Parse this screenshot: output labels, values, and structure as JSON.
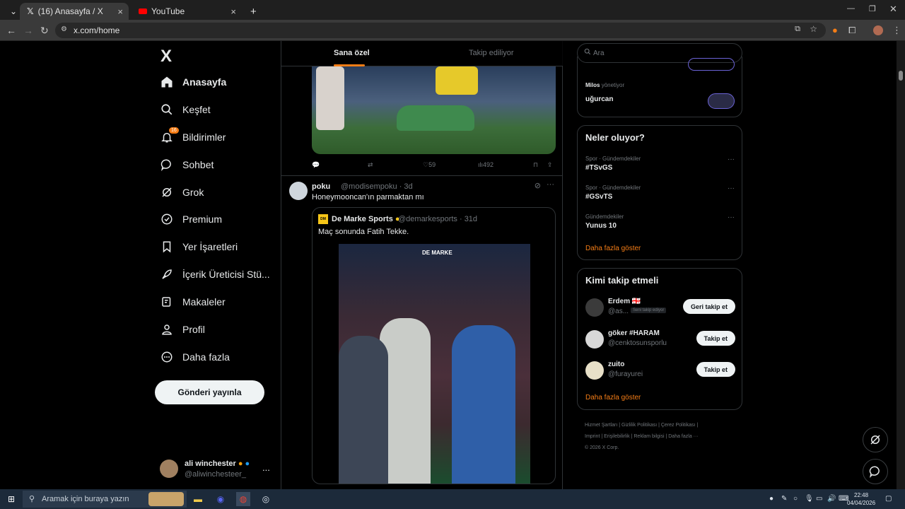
{
  "browser": {
    "tabs": [
      {
        "label": "(16) Anasayfa / X",
        "close": "×"
      },
      {
        "label": "YouTube",
        "close": "×"
      }
    ],
    "new_tab": "+",
    "url": "x.com/home"
  },
  "sidebar": {
    "logo": "X",
    "items": [
      {
        "label": "Anasayfa"
      },
      {
        "label": "Keşfet"
      },
      {
        "label": "Bildirimler",
        "badge": "16"
      },
      {
        "label": "Sohbet"
      },
      {
        "label": "Grok"
      },
      {
        "label": "Premium"
      },
      {
        "label": "Yer İşaretleri"
      },
      {
        "label": "İçerik Üreticisi Stü..."
      },
      {
        "label": "Makaleler"
      },
      {
        "label": "Profil"
      },
      {
        "label": "Daha fazla"
      }
    ],
    "post_button": "Gönderi yayınla",
    "account": {
      "name": "ali winchester",
      "handle": "@aliwinchesteer_",
      "more": "..."
    }
  },
  "feed": {
    "tabs": [
      {
        "label": "Sana özel"
      },
      {
        "label": "Takip ediliyor"
      }
    ],
    "tweet1_actions": {
      "likes": "59",
      "views": "492"
    },
    "tweet2": {
      "name": "poku",
      "meta": "@modisempoku · 3d",
      "text": "Honeymooncan'ın parmaktan mı",
      "more": "···",
      "quote": {
        "name": "De Marke Sports",
        "meta": "@demarkesports · 31d",
        "text": "Maç sonunda Fatih Tekke.",
        "watermark": "DE MARKE"
      }
    }
  },
  "right": {
    "search_placeholder": "Ara",
    "community": {
      "manager": "Milos",
      "manager_suffix": "yönetiyor",
      "name": "uğurcan"
    },
    "trends": {
      "title": "Neler oluyor?",
      "items": [
        {
          "category": "Spor · Gündemdekiler",
          "name": "#TSvGS"
        },
        {
          "category": "Spor · Gündemdekiler",
          "name": "#GSvTS"
        },
        {
          "category": "Gündemdekiler",
          "name": "Yunus 10"
        }
      ],
      "show_more": "Daha fazla göster"
    },
    "who_to_follow": {
      "title": "Kimi takip etmeli",
      "items": [
        {
          "name": "Erdem 🇬🇪",
          "handle": "@as...",
          "badge": "Seni takip ediyor",
          "button": "Geri takip et"
        },
        {
          "name": "göker #HARAM",
          "handle": "@cenktosunsporlu",
          "button": "Takip et"
        },
        {
          "name": "zuito",
          "handle": "@furayurei",
          "button": "Takip et"
        }
      ],
      "show_more": "Daha fazla göster"
    },
    "footer": {
      "line1": "Hizmet Şartları  |  Gizlilik Politikası  |  Çerez Politikası  |",
      "line2": "Imprint  |  Erişilebilirlik  |  Reklam bilgisi  |  Daha fazla ···",
      "line3": "© 2026 X Corp."
    }
  },
  "taskbar": {
    "search_placeholder": "Aramak için buraya yazın",
    "time": "22:48",
    "date": "04/04/2026"
  }
}
